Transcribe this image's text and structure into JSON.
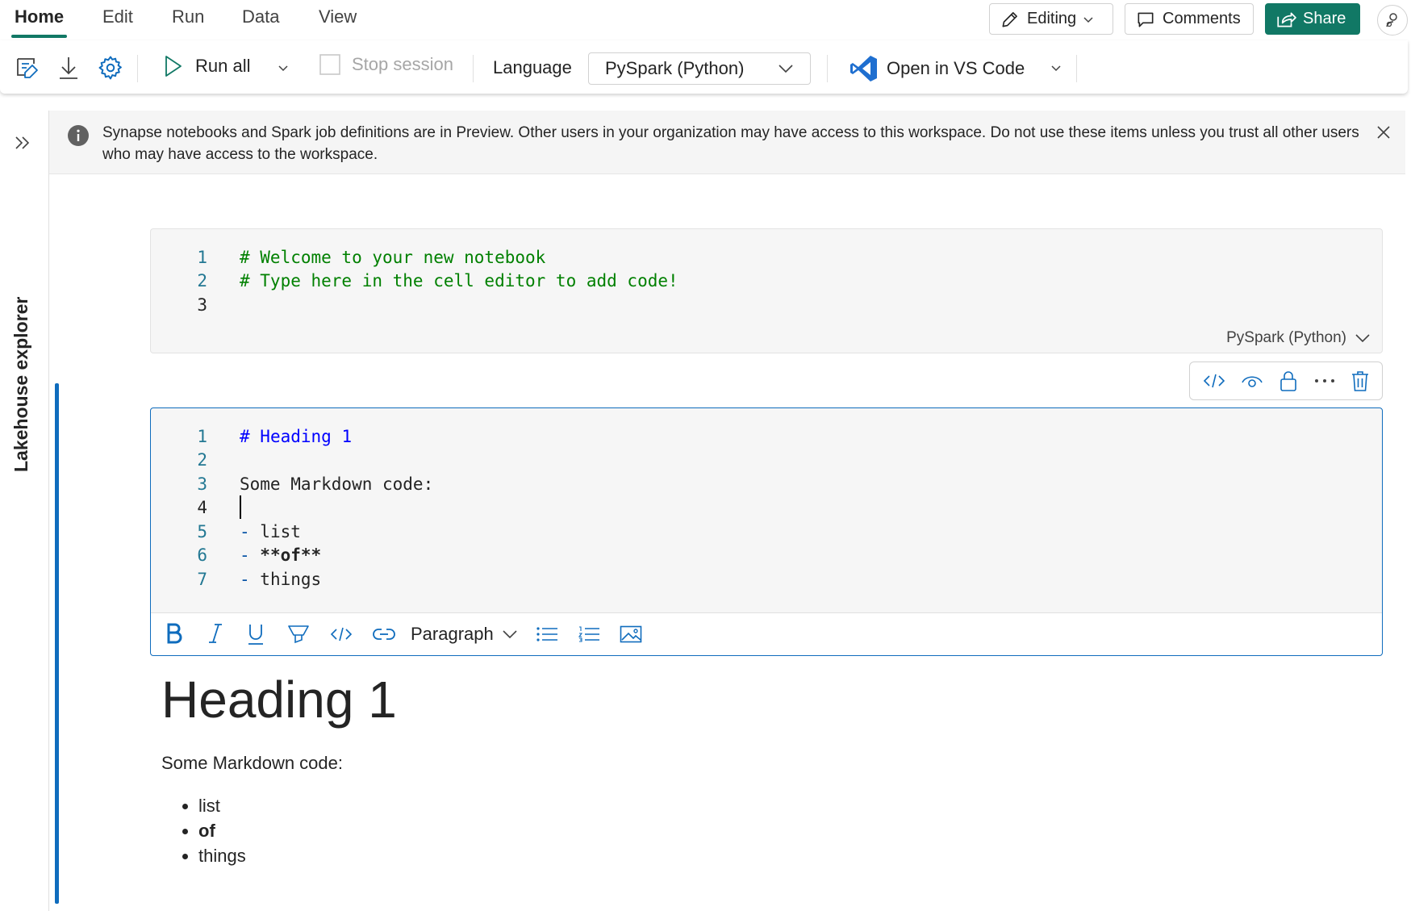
{
  "tabs": [
    {
      "label": "Home",
      "active": true
    },
    {
      "label": "Edit"
    },
    {
      "label": "Run"
    },
    {
      "label": "Data"
    },
    {
      "label": "View"
    }
  ],
  "header": {
    "editing_label": "Editing",
    "comments_label": "Comments",
    "share_label": "Share"
  },
  "ribbon": {
    "run_all_label": "Run all",
    "stop_session_label": "Stop session",
    "language_label": "Language",
    "language_value": "PySpark (Python)",
    "vscode_label": "Open in VS Code"
  },
  "sidebar": {
    "lakehouse_label": "Lakehouse explorer"
  },
  "banner": {
    "text": "Synapse notebooks and Spark job definitions are in Preview. Other users in your organization may have access to this workspace. Do not use these items unless you trust all other users who may have access to the workspace."
  },
  "cell1": {
    "lines": [
      {
        "num": "1",
        "text": "# Welcome to your new notebook"
      },
      {
        "num": "2",
        "text": "# Type here in the cell editor to add code!"
      },
      {
        "num": "3",
        "text": ""
      }
    ],
    "language": "PySpark (Python)"
  },
  "cell2": {
    "lines": [
      {
        "num": "1",
        "marker": "#",
        "text": " Heading 1"
      },
      {
        "num": "2",
        "text": ""
      },
      {
        "num": "3",
        "text": "Some Markdown code:"
      },
      {
        "num": "4",
        "text": ""
      },
      {
        "num": "5",
        "marker": "-",
        "text": " list"
      },
      {
        "num": "6",
        "marker": "-",
        "text": " **of**"
      },
      {
        "num": "7",
        "marker": "-",
        "text": " things"
      }
    ],
    "toolbar": {
      "paragraph_label": "Paragraph"
    }
  },
  "rendered": {
    "heading": "Heading 1",
    "paragraph": "Some Markdown code:",
    "items": [
      "list",
      "of",
      "things"
    ]
  },
  "colors": {
    "accent": "#117865",
    "focus": "#0f6cbd",
    "comment": "#008000",
    "line_number": "#237893"
  }
}
